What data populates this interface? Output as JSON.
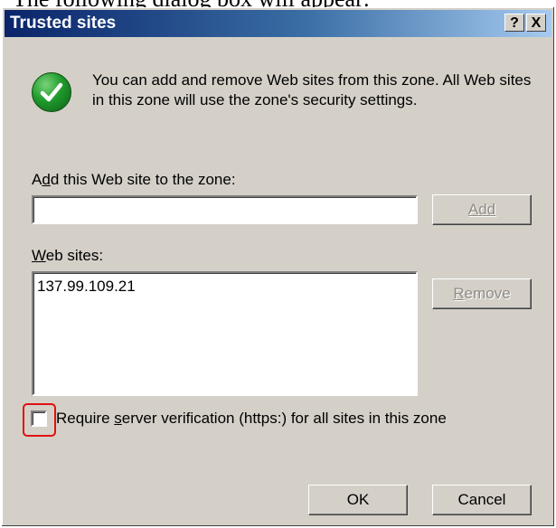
{
  "doc_fragment": "The following dialog box will appear:",
  "dialog": {
    "title": "Trusted sites",
    "help_button": "?",
    "close_button": "X",
    "icon": "green-checkmark-icon",
    "intro_text": "You can add and remove Web sites from this zone. All Web sites in this zone will use the zone's security settings.",
    "add_label": "Add this Web site to the zone:",
    "add_input_value": "",
    "add_button": "Add",
    "websites_label": "Web sites:",
    "websites": [
      "137.99.109.21"
    ],
    "remove_button": "Remove",
    "require_verification": {
      "label": "Require server verification (https:) for all sites in this zone",
      "checked": false
    },
    "ok_button": "OK",
    "cancel_button": "Cancel"
  },
  "colors": {
    "dialog_bg": "#d4d0c8",
    "title_start": "#0a246a",
    "title_end": "#a6caf0",
    "highlight": "#e11010",
    "icon_green": "#1f9a2c"
  }
}
